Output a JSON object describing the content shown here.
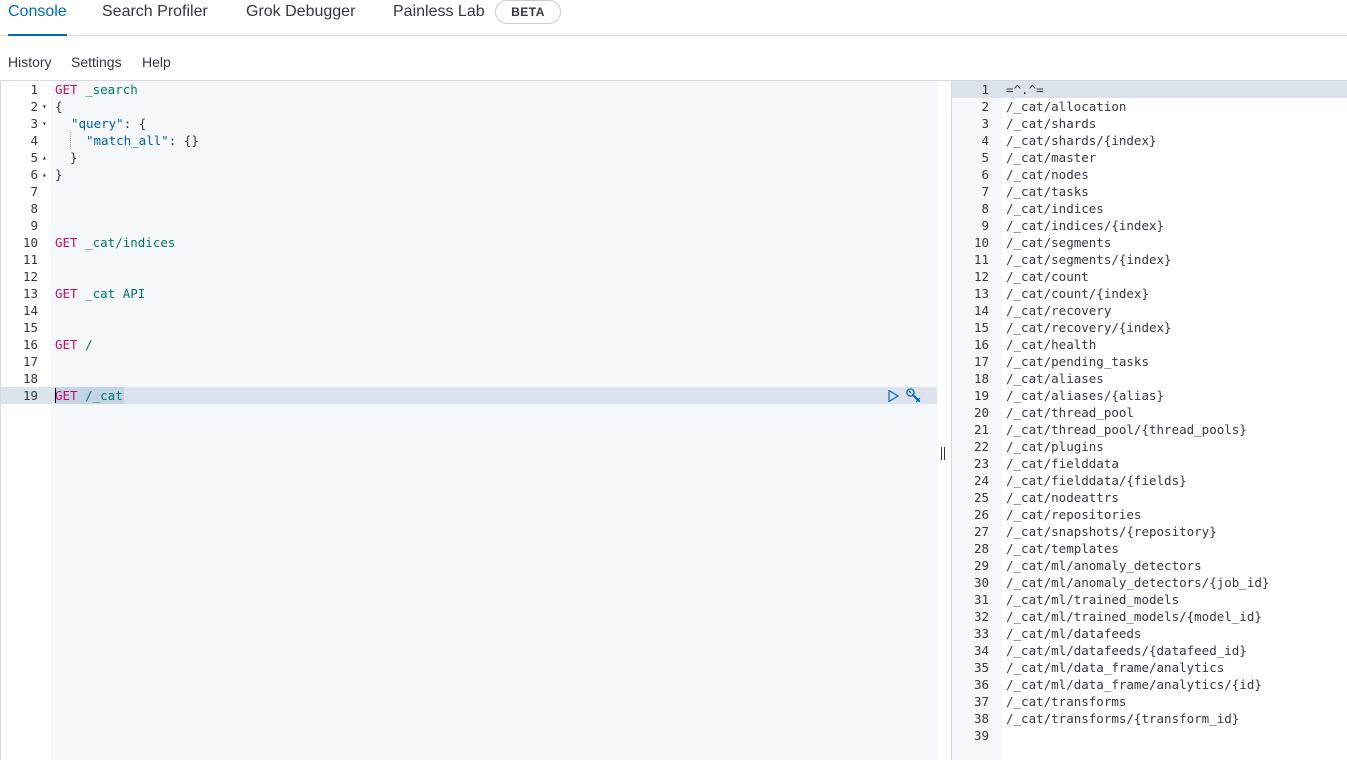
{
  "tabs": [
    {
      "label": "Console",
      "active": true
    },
    {
      "label": "Search Profiler",
      "active": false
    },
    {
      "label": "Grok Debugger",
      "active": false
    },
    {
      "label": "Painless Lab",
      "active": false
    }
  ],
  "beta_badge": "BETA",
  "menu": {
    "history": "History",
    "settings": "Settings",
    "help": "Help"
  },
  "request_editor": {
    "line_numbers": [
      "1",
      "2",
      "3",
      "4",
      "5",
      "6",
      "7",
      "8",
      "9",
      "10",
      "11",
      "12",
      "13",
      "14",
      "15",
      "16",
      "17",
      "18",
      "19"
    ],
    "lines": {
      "l1_method": "GET",
      "l1_path": " _search",
      "l2": "{",
      "l3_key": "\"query\"",
      "l3_rest": ": {",
      "l4_key": "\"match_all\"",
      "l4_rest": ": {}",
      "l5": "}",
      "l6": "}",
      "l10_method": "GET",
      "l10_path": " _cat/indices",
      "l13_method": "GET",
      "l13_path": " _cat API",
      "l16_method": "GET",
      "l16_path": " /",
      "l19_method": "GET",
      "l19_path": " /_cat"
    },
    "active_line": 19,
    "icons": {
      "run": "play-icon",
      "wrench": "wrench-icon"
    }
  },
  "response_editor": {
    "line_numbers": [
      "1",
      "2",
      "3",
      "4",
      "5",
      "6",
      "7",
      "8",
      "9",
      "10",
      "11",
      "12",
      "13",
      "14",
      "15",
      "16",
      "17",
      "18",
      "19",
      "20",
      "21",
      "22",
      "23",
      "24",
      "25",
      "26",
      "27",
      "28",
      "29",
      "30",
      "31",
      "32",
      "33",
      "34",
      "35",
      "36",
      "37",
      "38",
      "39"
    ],
    "lines": [
      "=^.^=",
      "/_cat/allocation",
      "/_cat/shards",
      "/_cat/shards/{index}",
      "/_cat/master",
      "/_cat/nodes",
      "/_cat/tasks",
      "/_cat/indices",
      "/_cat/indices/{index}",
      "/_cat/segments",
      "/_cat/segments/{index}",
      "/_cat/count",
      "/_cat/count/{index}",
      "/_cat/recovery",
      "/_cat/recovery/{index}",
      "/_cat/health",
      "/_cat/pending_tasks",
      "/_cat/aliases",
      "/_cat/aliases/{alias}",
      "/_cat/thread_pool",
      "/_cat/thread_pool/{thread_pools}",
      "/_cat/plugins",
      "/_cat/fielddata",
      "/_cat/fielddata/{fields}",
      "/_cat/nodeattrs",
      "/_cat/repositories",
      "/_cat/snapshots/{repository}",
      "/_cat/templates",
      "/_cat/ml/anomaly_detectors",
      "/_cat/ml/anomaly_detectors/{job_id}",
      "/_cat/ml/trained_models",
      "/_cat/ml/trained_models/{model_id}",
      "/_cat/ml/datafeeds",
      "/_cat/ml/datafeeds/{datafeed_id}",
      "/_cat/ml/data_frame/analytics",
      "/_cat/ml/data_frame/analytics/{id}",
      "/_cat/transforms",
      "/_cat/transforms/{transform_id}",
      ""
    ]
  },
  "colors": {
    "accent": "#006bb8",
    "method": "#c80a68",
    "path": "#00756c",
    "string_key": "#0061a6"
  }
}
